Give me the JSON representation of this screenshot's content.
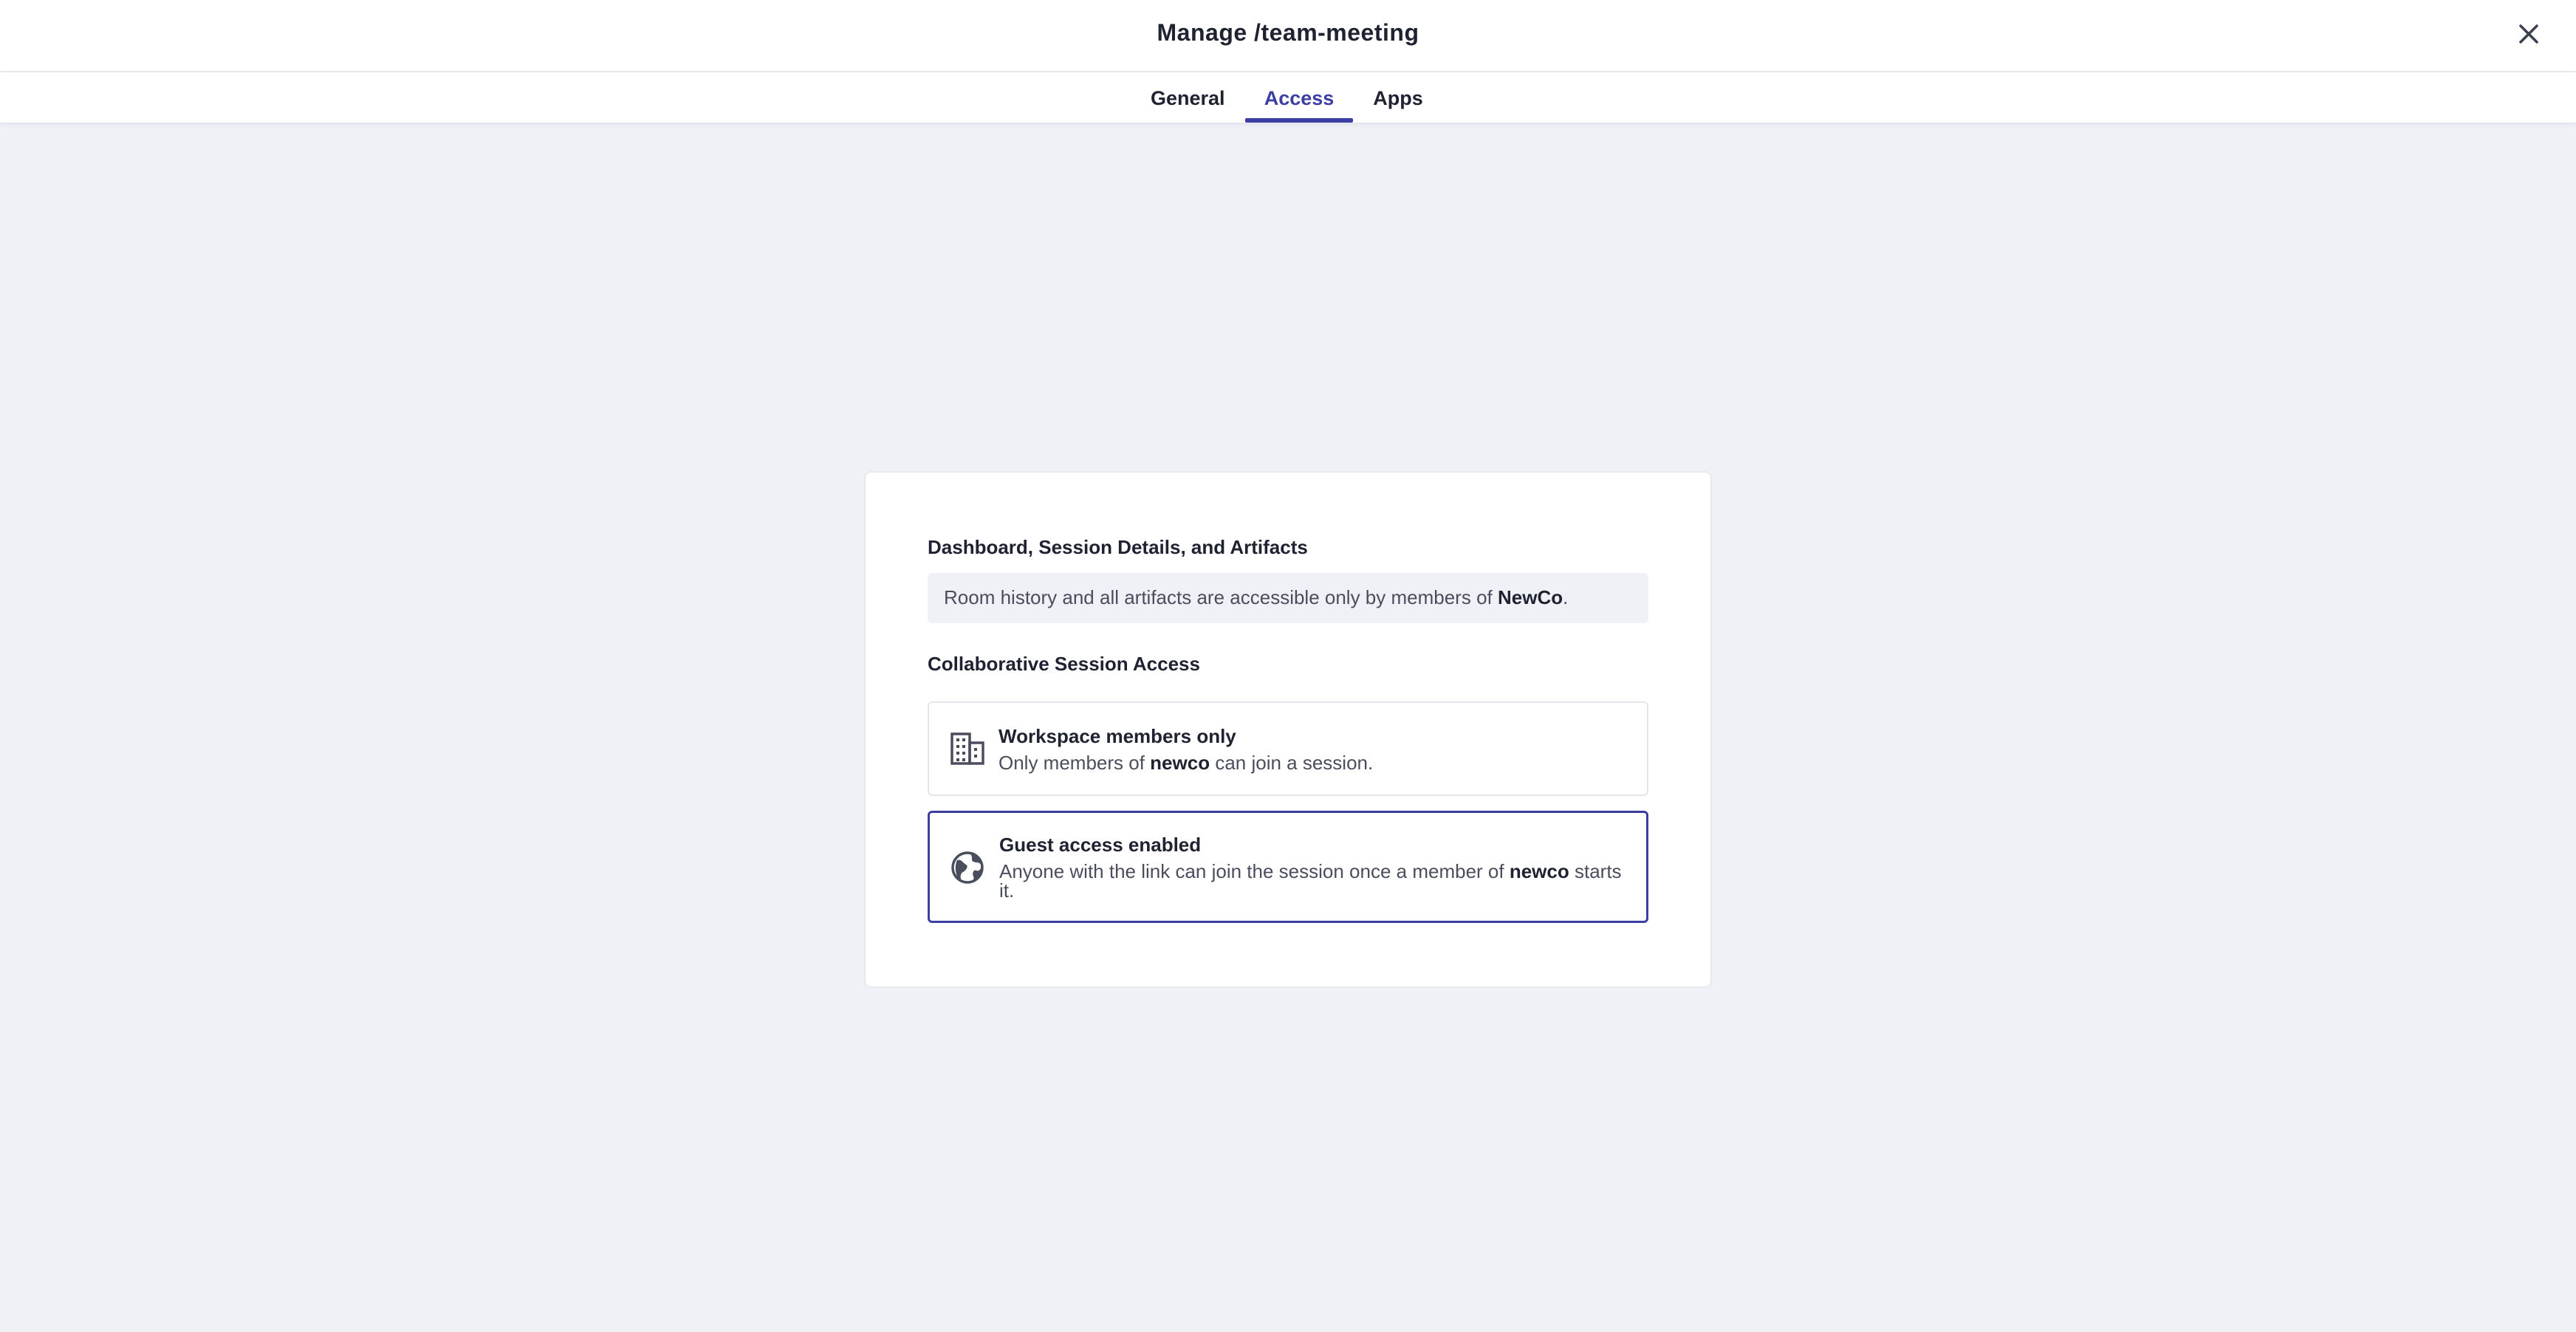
{
  "header": {
    "title": "Manage /team-meeting",
    "close_icon": "close-icon"
  },
  "tabs": [
    {
      "label": "General",
      "active": false
    },
    {
      "label": "Access",
      "active": true
    },
    {
      "label": "Apps",
      "active": false
    }
  ],
  "card": {
    "dashboard_section": {
      "label": "Dashboard, Session Details, and Artifacts",
      "info_prefix": "Room history and all artifacts are accessible only by members of ",
      "info_org": "NewCo",
      "info_suffix": "."
    },
    "collab_section": {
      "label": "Collaborative Session Access",
      "options": [
        {
          "icon": "building-icon",
          "title": "Workspace members only",
          "desc_prefix": "Only members of ",
          "desc_org": "newco",
          "desc_suffix": " can join a session.",
          "selected": false
        },
        {
          "icon": "globe-icon",
          "title": "Guest access enabled",
          "desc_prefix": "Anyone with the link can join the session once a member of ",
          "desc_org": "newco",
          "desc_suffix": " starts it.",
          "selected": true
        }
      ]
    }
  },
  "colors": {
    "accent": "#3b3fa3",
    "background": "#eef1f6",
    "card": "#ffffff",
    "info_box": "#f0f1f6"
  }
}
